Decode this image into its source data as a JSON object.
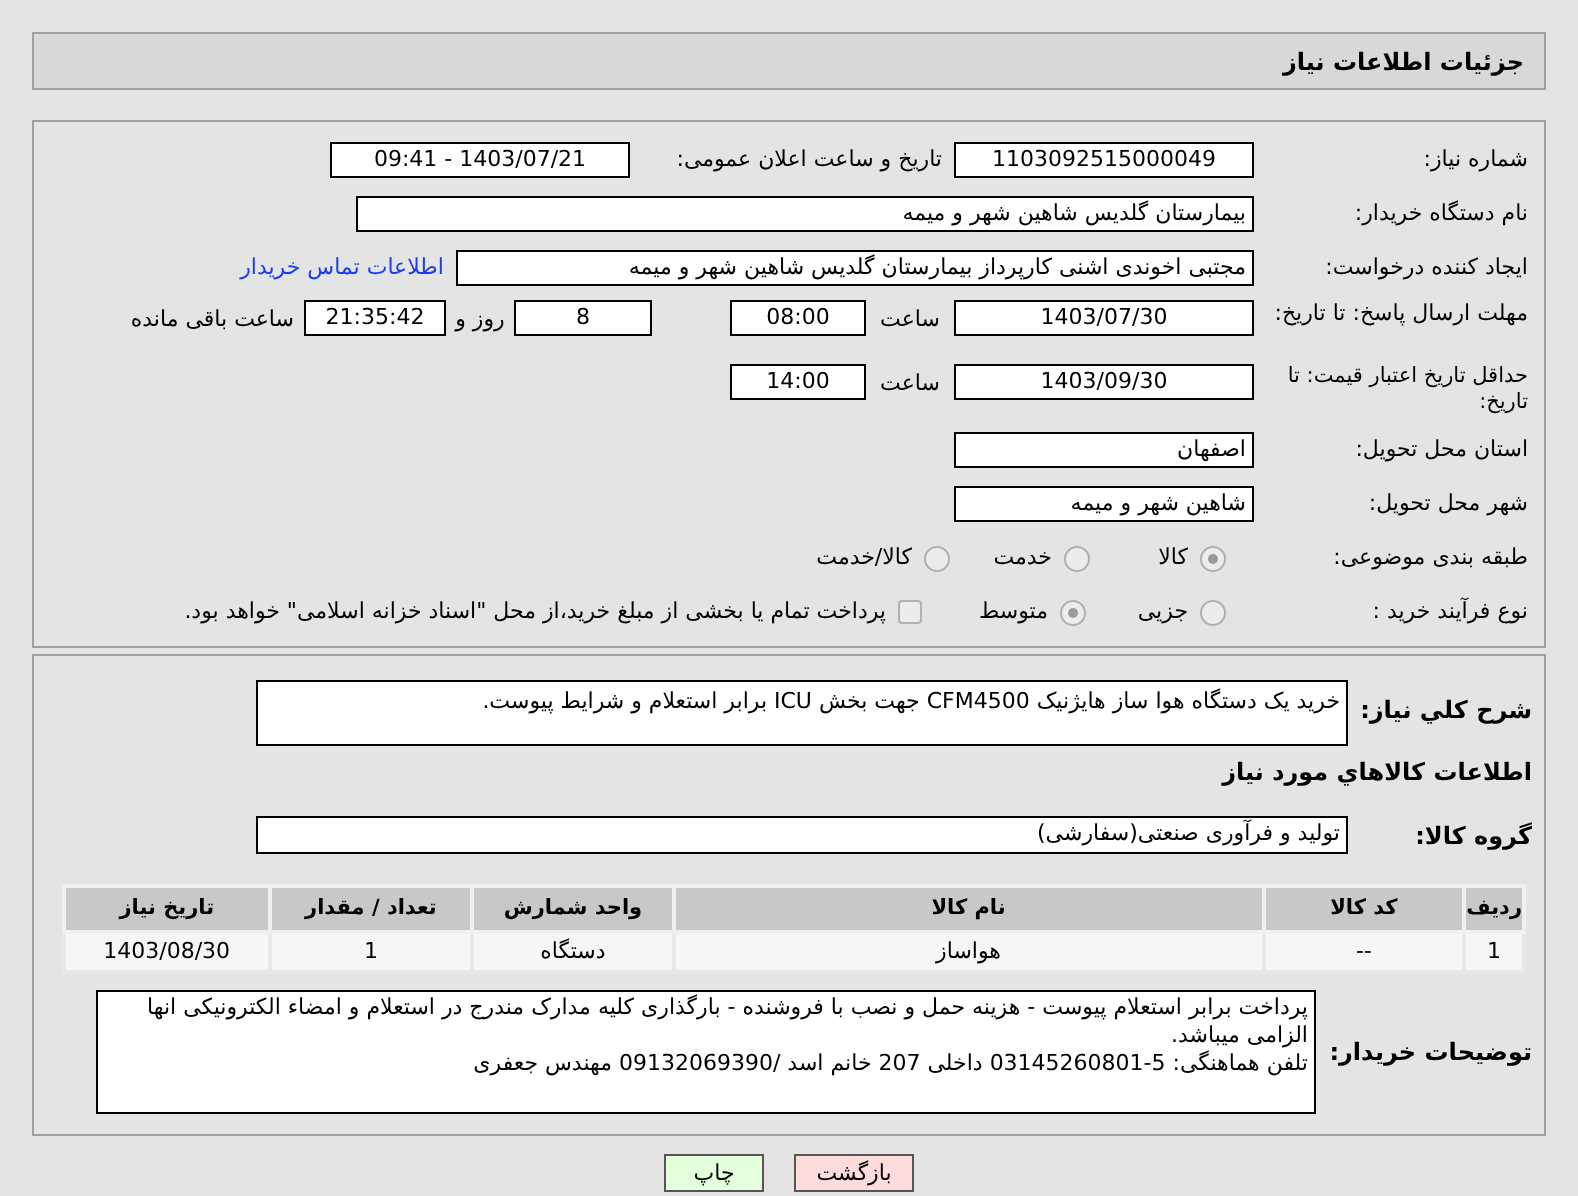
{
  "header": {
    "title": "جزئیات اطلاعات نیاز"
  },
  "need_number": {
    "label": "شماره نیاز:",
    "value": "1103092515000049"
  },
  "announce_datetime": {
    "label": "تاریخ و ساعت اعلان عمومی:",
    "value": "1403/07/21 - 09:41"
  },
  "buyer_org": {
    "label": "نام دستگاه خریدار:",
    "value": "بیمارستان گلدیس  شاهین شهر و میمه"
  },
  "requester": {
    "label": "ایجاد کننده درخواست:",
    "value": "مجتبی اخوندی اشنی کارپرداز بیمارستان گلدیس  شاهین شهر و میمه",
    "contact_link": "اطلاعات تماس خریدار"
  },
  "response_deadline": {
    "label": "مهلت ارسال پاسخ: تا تاریخ:",
    "date": "1403/07/30",
    "time_label": "ساعت",
    "time": "08:00",
    "days": "8",
    "days_label": "روز و",
    "remaining": "21:35:42",
    "remaining_label": "ساعت باقی مانده"
  },
  "price_validity": {
    "label": "حداقل تاریخ اعتبار قیمت: تا تاریخ:",
    "date": "1403/09/30",
    "time_label": "ساعت",
    "time": "14:00"
  },
  "delivery_province": {
    "label": "استان محل تحویل:",
    "value": "اصفهان"
  },
  "delivery_city": {
    "label": "شهر محل تحویل:",
    "value": "شاهین شهر و میمه"
  },
  "subject_category": {
    "label": "طبقه بندی موضوعی:",
    "options": [
      {
        "label": "کالا",
        "selected": true
      },
      {
        "label": "خدمت",
        "selected": false
      },
      {
        "label": "کالا/خدمت",
        "selected": false
      }
    ]
  },
  "purchase_process": {
    "label": "نوع فرآیند خرید :",
    "options": [
      {
        "label": "جزیی",
        "selected": false
      },
      {
        "label": "متوسط",
        "selected": true
      }
    ],
    "treasury": {
      "label": "پرداخت تمام یا بخشی از مبلغ خرید،از محل \"اسناد خزانه اسلامی\" خواهد بود.",
      "checked": false
    }
  },
  "description": {
    "label": "شرح كلي نياز:",
    "value": "خرید یک دستگاه هوا ساز هایژنیک CFM4500 جهت بخش ICU برابر استعلام و شرایط پیوست."
  },
  "goods_section": {
    "title": "اطلاعات كالاهاي مورد نياز"
  },
  "goods_group": {
    "label": "گروه کالا:",
    "value": "تولید و فرآوری صنعتی(سفارشی)"
  },
  "table": {
    "columns": [
      "ردیف",
      "کد کالا",
      "نام کالا",
      "واحد شمارش",
      "تعداد / مقدار",
      "تاریخ نیاز"
    ],
    "rows": [
      [
        "1",
        "--",
        "هواساز",
        "دستگاه",
        "1",
        "1403/08/30"
      ]
    ]
  },
  "buyer_notes": {
    "label": "توضیحات خریدار:",
    "lines": [
      "پرداخت برابر استعلام پیوست - هزینه حمل و نصب با فروشنده - بارگذاری کلیه مدارک مندرج در استعلام و امضاء الکترونیکی انها الزامی میباشد.",
      "تلفن هماهنگی: 5-03145260801 داخلی 207 خانم اسد /09132069390 مهندس جعفری"
    ]
  },
  "buttons": [
    {
      "label": "بازگشت",
      "kind": "back"
    },
    {
      "label": "چاپ",
      "kind": "print"
    }
  ]
}
